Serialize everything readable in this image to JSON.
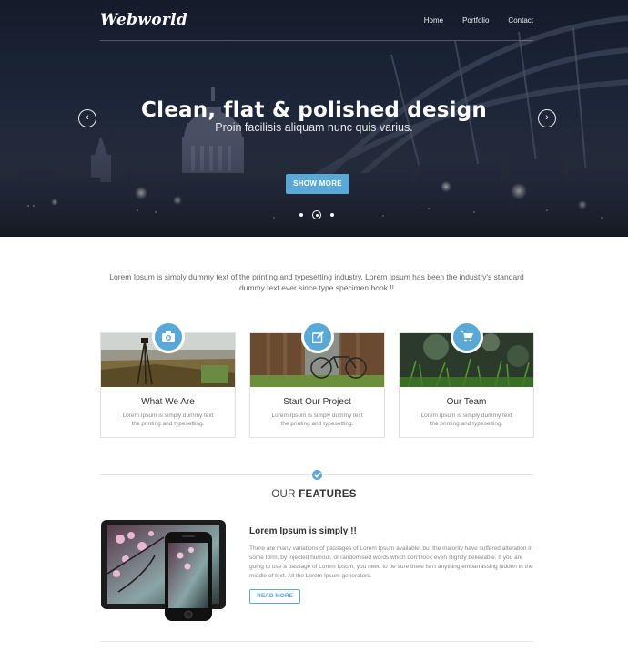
{
  "header": {
    "logo": "Webworld",
    "nav": [
      {
        "label": "Home"
      },
      {
        "label": "Portfolio"
      },
      {
        "label": "Contact"
      }
    ]
  },
  "hero": {
    "title": "Clean, flat & polished design",
    "subtitle": "Proin facilisis aliquam nunc quis varius.",
    "button_label": "SHOW MORE",
    "prev_icon": "chevron-left-icon",
    "next_icon": "chevron-right-icon",
    "slide_count": 3,
    "active_slide": 2
  },
  "intro": {
    "text": "Lorem Ipsum is simply dummy text of the printing and typesetting industry. Lorem Ipsum has been the industry's standard dummy text ever since type specimen book !!"
  },
  "cards": [
    {
      "title": "What We Are",
      "text": "Lorem Ipsum is simply dummy text the printing and typesetting.",
      "icon": "camera-icon"
    },
    {
      "title": "Start Our Project",
      "text": "Lorem Ipsum is simply dummy text the printing and typesetting.",
      "icon": "edit-icon"
    },
    {
      "title": "Our Team",
      "text": "Lorem Ipsum is simply dummy text the printing and typesetting.",
      "icon": "cart-icon"
    }
  ],
  "features": {
    "title_light": "OUR",
    "title_bold": "FEATURES",
    "heading": "Lorem Ipsum is simply !!",
    "body": "There are many variations of passages of Lorem Ipsum available, but the majority have suffered alteration in some form, by injected humour, or randomised words which don't look even slightly believable. If you are going to use a passage of Lorem Ipsum, you need to be sure there isn't anything embarrassing hidden in the middle of text. All the Lorem Ipsum generators.",
    "button_label": "READ MORE"
  },
  "colors": {
    "accent": "#5aa8d6",
    "hero_dark": "#1c2538"
  }
}
